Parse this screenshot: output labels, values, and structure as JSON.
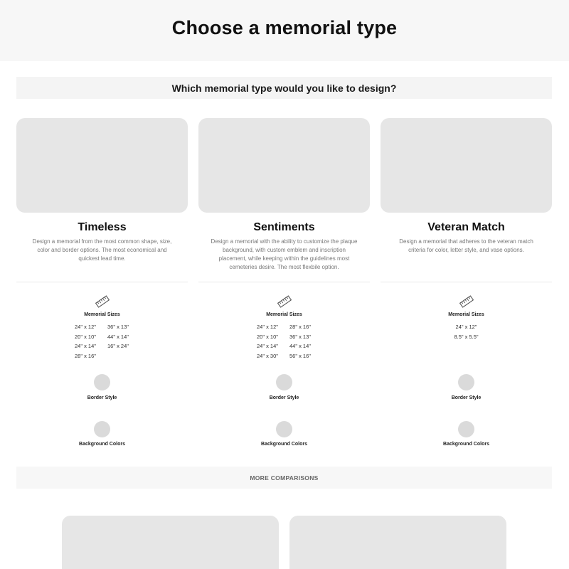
{
  "page": {
    "title": "Choose a memorial type"
  },
  "question": {
    "text": "Which memorial type would you like to design?"
  },
  "labels": {
    "sizes": "Memorial Sizes",
    "border": "Border Style",
    "background": "Background Colors"
  },
  "cards": [
    {
      "title": "Timeless",
      "description": "Design a memorial from the most common shape, size, color and border options. The most economical and quickest lead time.",
      "sizes_left": [
        "24\" x 12\"",
        "20\" x 10\"",
        "24\" x 14\"",
        "28\" x 16\""
      ],
      "sizes_right": [
        "36\" x 13\"",
        "44\" x 14\"",
        "16\" x 24\""
      ]
    },
    {
      "title": "Sentiments",
      "description": "Design a memorial with the ability to customize the plaque background, with custom emblem and inscription placement, while keeping within the guidelines most cemeteries desire. The most flexbile option.",
      "sizes_left": [
        "24\" x 12\"",
        "20\" x 10\"",
        "24\" x 14\"",
        "24\" x 30\""
      ],
      "sizes_right": [
        "28\" x 16\"",
        "36\" x 13\"",
        "44\" x 14\"",
        "56\" x 16\""
      ]
    },
    {
      "title": "Veteran Match",
      "description": "Design a memorial that adheres to the veteran match criteria for color, letter style, and vase options.",
      "sizes_left": [
        "24\" x 12\"",
        "8.5\" x 5.5\""
      ],
      "sizes_right": []
    }
  ],
  "more": {
    "label": "MORE COMPARISONS"
  },
  "colors": {
    "placeholder": "#e6e6e6",
    "swatch": "#dadada",
    "header_bg": "#f7f7f7"
  },
  "icons": {
    "sizes": "ruler-icon"
  }
}
